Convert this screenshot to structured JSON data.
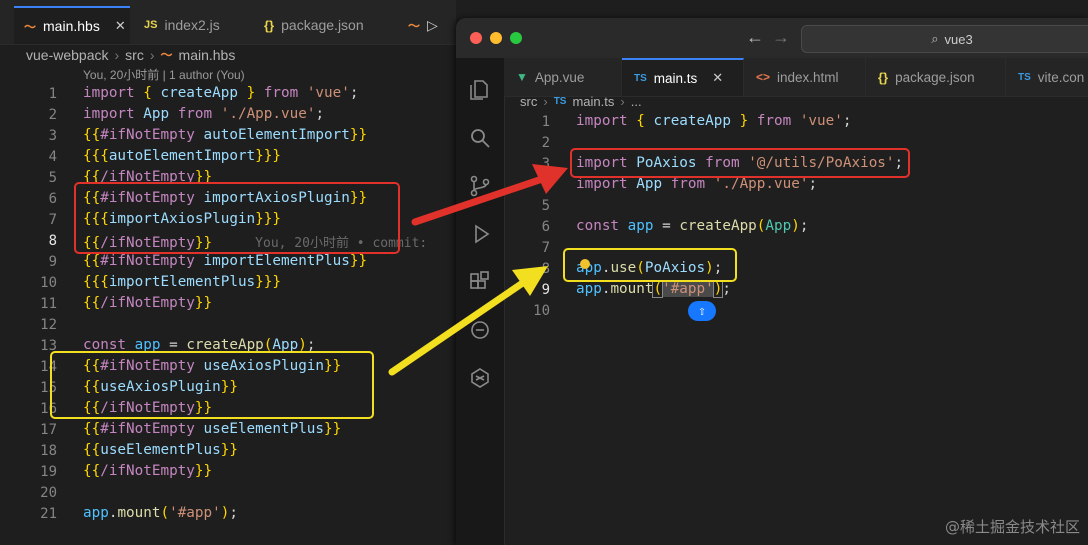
{
  "left": {
    "tabs": [
      {
        "label": "main.hbs",
        "icon": "handlebars-icon",
        "active": true
      },
      {
        "label": "index2.js",
        "icon": "js-icon"
      },
      {
        "label": "package.json",
        "icon": "json-icon"
      }
    ],
    "breadcrumb": [
      "vue-webpack",
      "src",
      "main.hbs"
    ],
    "blame": "You, 20小时前 | 1 author (You)",
    "inline_blame": "You, 20小时前 • commit:",
    "line_numbers": [
      "1",
      "2",
      "3",
      "4",
      "5",
      "6",
      "7",
      "8",
      "9",
      "10",
      "11",
      "12",
      "13",
      "14",
      "15",
      "16",
      "17",
      "18",
      "19",
      "20",
      "21"
    ],
    "current_line": "8"
  },
  "right": {
    "search": "vue3",
    "tabs": [
      {
        "label": "App.vue",
        "icon": "vue-icon"
      },
      {
        "label": "main.ts",
        "icon": "ts-icon",
        "active": true
      },
      {
        "label": "index.html",
        "icon": "html-icon"
      },
      {
        "label": "package.json",
        "icon": "json-icon"
      },
      {
        "label": "vite.con",
        "icon": "ts-icon"
      }
    ],
    "breadcrumb": [
      "src",
      "main.ts",
      "..."
    ],
    "line_numbers": [
      "1",
      "2",
      "3",
      "4",
      "5",
      "6",
      "7",
      "8",
      "9",
      "10"
    ],
    "current_line": "9"
  },
  "annotations": {
    "red_color": "#e0322a",
    "yellow_color": "#f2df1f"
  },
  "watermark": "@稀土掘金技术社区"
}
